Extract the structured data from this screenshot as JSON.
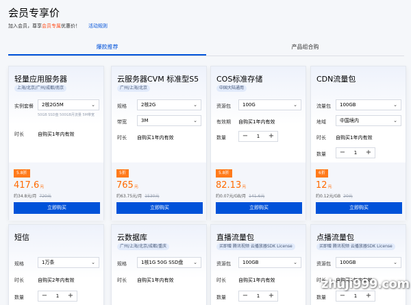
{
  "page": {
    "title": "会员专享价",
    "sub_prefix": "加入会员，尊享",
    "sub_em": "会员专属",
    "sub_suffix": "优惠价！",
    "rules_link": "活动规则"
  },
  "tabs": [
    {
      "label": "爆款推荐"
    },
    {
      "label": "产品组合购"
    }
  ],
  "cards": {
    "lighthouse": {
      "title": "轻量应用服务器",
      "tag": "上海/北京/广州/成都/南京",
      "spec_label": "实例套餐",
      "spec_value": "2核2G5M",
      "spec_note": "50GB SSD盘 500GB月流量 5M带宽",
      "duration_label": "时长",
      "duration_value": "自购买1年内有效",
      "discount": "5.8折",
      "price": "417.6",
      "unit": "元",
      "per": "约34.8元/月",
      "old": "720元",
      "buy": "立即购买"
    },
    "cvm": {
      "title": "云服务器CVM 标准型S5",
      "tag": "广州/上海/北京",
      "spec_label": "规格",
      "spec_value": "2核2G",
      "bw_label": "带宽",
      "bw_value": "3M",
      "duration_label": "时长",
      "duration_value": "自购买1年内有效",
      "discount": "5折",
      "price": "765",
      "unit": "元",
      "per": "约63.75元/月",
      "old": "1530元",
      "buy": "立即购买"
    },
    "cos": {
      "title": "COS标准存储",
      "tag": "中国大陆通用",
      "pack_label": "资源包",
      "pack_value": "100G",
      "valid_label": "有效期",
      "valid_value": "自购买1年内有效",
      "qty_label": "数量",
      "qty": "1",
      "discount": "5.8折",
      "price": "82.13",
      "unit": "元",
      "per": "约0.07元/GB/月",
      "old": "141.6元",
      "buy": "立即购买"
    },
    "cdn": {
      "title": "CDN流量包",
      "pack_label": "流量包",
      "pack_value": "100GB",
      "region_label": "地域",
      "region_value": "中国境内",
      "duration_label": "时长",
      "duration_value": "自购买1年内有效",
      "qty_label": "数量",
      "qty": "1",
      "discount": "6折",
      "price": "12",
      "unit": "元",
      "per": "约0.12元/GB",
      "old": "20元",
      "buy": "立即购买"
    },
    "sms": {
      "title": "短信",
      "spec_label": "规格",
      "spec_value": "1万条",
      "duration_label": "时长",
      "duration_value": "自购买2年内有效",
      "qty_label": "数量",
      "qty": "1"
    },
    "db": {
      "title": "云数据库",
      "tag": "广州/上海/北京/成都/重庆",
      "spec_label": "规格",
      "spec_value": "1核1G 50G SSD盘",
      "duration_label": "时长",
      "duration_value": "自购买1年内有效"
    },
    "live": {
      "title": "直播流量包",
      "tag": "买即赠 腾讯视频 云播放器SDK License",
      "pack_label": "资源包",
      "pack_value": "100GB",
      "duration_label": "时长",
      "duration_value": "自购买1年内有效",
      "qty_label": "数量",
      "qty": "1"
    },
    "vod": {
      "title": "点播流量包",
      "tag": "买即赠 腾讯视频 云播放器SDK License",
      "pack_label": "资源包",
      "pack_value": "100GB",
      "duration_label": "时长",
      "duration_value": "自购买1年内有效",
      "qty_label": "数量",
      "qty": "1"
    }
  },
  "watermark": "zhuji999.com",
  "icons": {
    "select": "chevron-down-icon",
    "minus": "minus-icon",
    "plus": "plus-icon"
  },
  "colors": {
    "accent": "#0052d9",
    "price": "#ff6a00",
    "discount": "#ff7a1a"
  }
}
